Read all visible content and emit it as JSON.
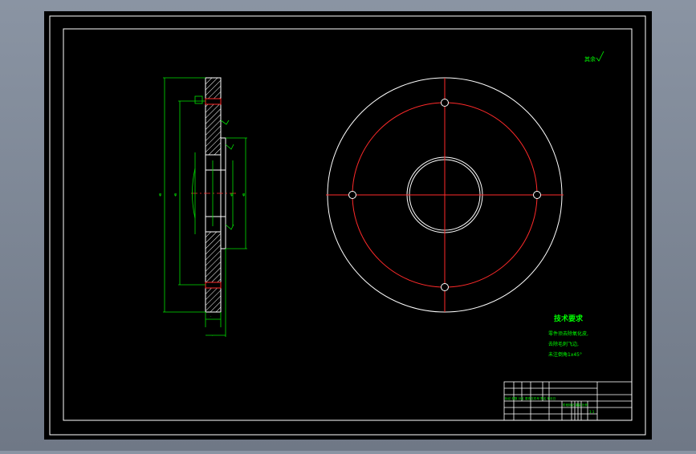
{
  "drawing": {
    "roughness_note": "其余",
    "tech_title": "技术要求",
    "tech_lines": [
      "零件须去除氧化皮,",
      "去除毛刺飞边,",
      "未注倒角1x45°"
    ],
    "title_block": {
      "row_a": "标记 处数 分区 更改文件号 签名 年月日",
      "row_b": "阶段标记 重量 比例",
      "scale": "1:1"
    }
  },
  "colors": {
    "sheet": "#000000",
    "border": "#ffffff",
    "part": "#ffffff",
    "centerline": "#ff2a2a",
    "dimension": "#00e000",
    "hatch": "#ffffff",
    "text": "#00ff00"
  }
}
